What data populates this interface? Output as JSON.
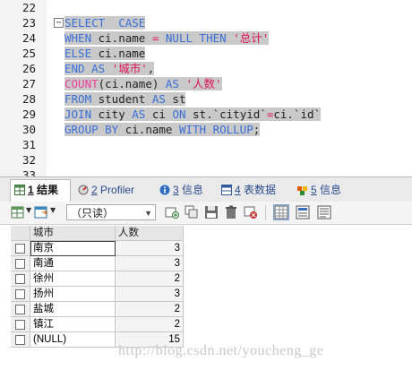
{
  "editor": {
    "lines": [
      {
        "n": "22",
        "segments": []
      },
      {
        "n": "23",
        "fold": "−",
        "segments": [
          {
            "t": "SELECT",
            "c": "kw",
            "s": 1
          },
          {
            "t": "  ",
            "c": "id",
            "s": 1
          },
          {
            "t": "CASE",
            "c": "kw",
            "s": 1
          }
        ]
      },
      {
        "n": "24",
        "segments": [
          {
            "t": "WHEN",
            "c": "kw",
            "s": 1
          },
          {
            "t": " ci.name ",
            "c": "id",
            "s": 1
          },
          {
            "t": "=",
            "c": "op",
            "s": 1
          },
          {
            "t": " ",
            "c": "id",
            "s": 1
          },
          {
            "t": "NULL",
            "c": "kw",
            "s": 1
          },
          {
            "t": " ",
            "c": "id",
            "s": 1
          },
          {
            "t": "THEN",
            "c": "kw",
            "s": 1
          },
          {
            "t": " ",
            "c": "id",
            "s": 1
          },
          {
            "t": "'总计'",
            "c": "str",
            "s": 1
          }
        ]
      },
      {
        "n": "25",
        "segments": [
          {
            "t": "ELSE",
            "c": "kw",
            "s": 1
          },
          {
            "t": " ci.name",
            "c": "id",
            "s": 1
          }
        ]
      },
      {
        "n": "26",
        "segments": [
          {
            "t": "END",
            "c": "kw",
            "s": 1
          },
          {
            "t": " ",
            "c": "id",
            "s": 1
          },
          {
            "t": "AS",
            "c": "kw",
            "s": 1
          },
          {
            "t": " ",
            "c": "id",
            "s": 1
          },
          {
            "t": "'城市'",
            "c": "str",
            "s": 1
          },
          {
            "t": ",",
            "c": "id",
            "s": 1
          }
        ]
      },
      {
        "n": "27",
        "segments": [
          {
            "t": "COUNT",
            "c": "fn",
            "s": 1
          },
          {
            "t": "(ci.name) ",
            "c": "id",
            "s": 1
          },
          {
            "t": "AS",
            "c": "kw",
            "s": 1
          },
          {
            "t": " ",
            "c": "id",
            "s": 1
          },
          {
            "t": "'人数'",
            "c": "str",
            "s": 1
          }
        ]
      },
      {
        "n": "28",
        "segments": [
          {
            "t": "FROM",
            "c": "kw",
            "s": 1
          },
          {
            "t": " student ",
            "c": "id",
            "s": 1
          },
          {
            "t": "AS",
            "c": "kw",
            "s": 1
          },
          {
            "t": " st",
            "c": "id",
            "s": 1
          }
        ]
      },
      {
        "n": "29",
        "segments": [
          {
            "t": "JOIN",
            "c": "kw",
            "s": 1
          },
          {
            "t": " city ",
            "c": "id",
            "s": 1
          },
          {
            "t": "AS",
            "c": "kw",
            "s": 1
          },
          {
            "t": " ci ",
            "c": "id",
            "s": 1
          },
          {
            "t": "ON",
            "c": "kw",
            "s": 1
          },
          {
            "t": " st.`cityid`",
            "c": "id",
            "s": 1
          },
          {
            "t": "=",
            "c": "op",
            "s": 1
          },
          {
            "t": "ci.`id`",
            "c": "id",
            "s": 1
          }
        ]
      },
      {
        "n": "30",
        "segments": [
          {
            "t": "GROUP BY",
            "c": "kw",
            "s": 1
          },
          {
            "t": " ci.name ",
            "c": "id",
            "s": 1
          },
          {
            "t": "WITH ROLLUP",
            "c": "kw",
            "s": 1
          },
          {
            "t": ";",
            "c": "id",
            "s": 1
          }
        ]
      },
      {
        "n": "31",
        "segments": []
      },
      {
        "n": "32",
        "segments": []
      },
      {
        "n": "33",
        "segments": []
      }
    ]
  },
  "tabs": [
    {
      "num": "1",
      "label": " 结果",
      "icon": "table-icon",
      "active": true
    },
    {
      "num": "2",
      "label": " Profiler",
      "icon": "profiler-icon",
      "active": false
    },
    {
      "num": "3",
      "label": " 信息",
      "icon": "info-icon",
      "active": false
    },
    {
      "num": "4",
      "label": " 表数据",
      "icon": "table-data-icon",
      "active": false
    },
    {
      "num": "5",
      "label": " 信息",
      "icon": "info2-icon",
      "active": false
    }
  ],
  "toolbar": {
    "mode_select": "（只读）"
  },
  "grid": {
    "columns": [
      "城市",
      "人数"
    ],
    "rows": [
      {
        "city": "南京",
        "count": "3"
      },
      {
        "city": "南通",
        "count": "3"
      },
      {
        "city": "徐州",
        "count": "2"
      },
      {
        "city": "扬州",
        "count": "3"
      },
      {
        "city": "盐城",
        "count": "2"
      },
      {
        "city": "镇江",
        "count": "2"
      },
      {
        "city": "(NULL)",
        "count": "15"
      }
    ]
  },
  "watermark": "http://blog.csdn.net/youcheng_ge",
  "colors": {
    "keyword": "#3a6fd8",
    "string": "#e0145a",
    "function": "#ee3ea0",
    "selection": "#c9c9c9"
  }
}
